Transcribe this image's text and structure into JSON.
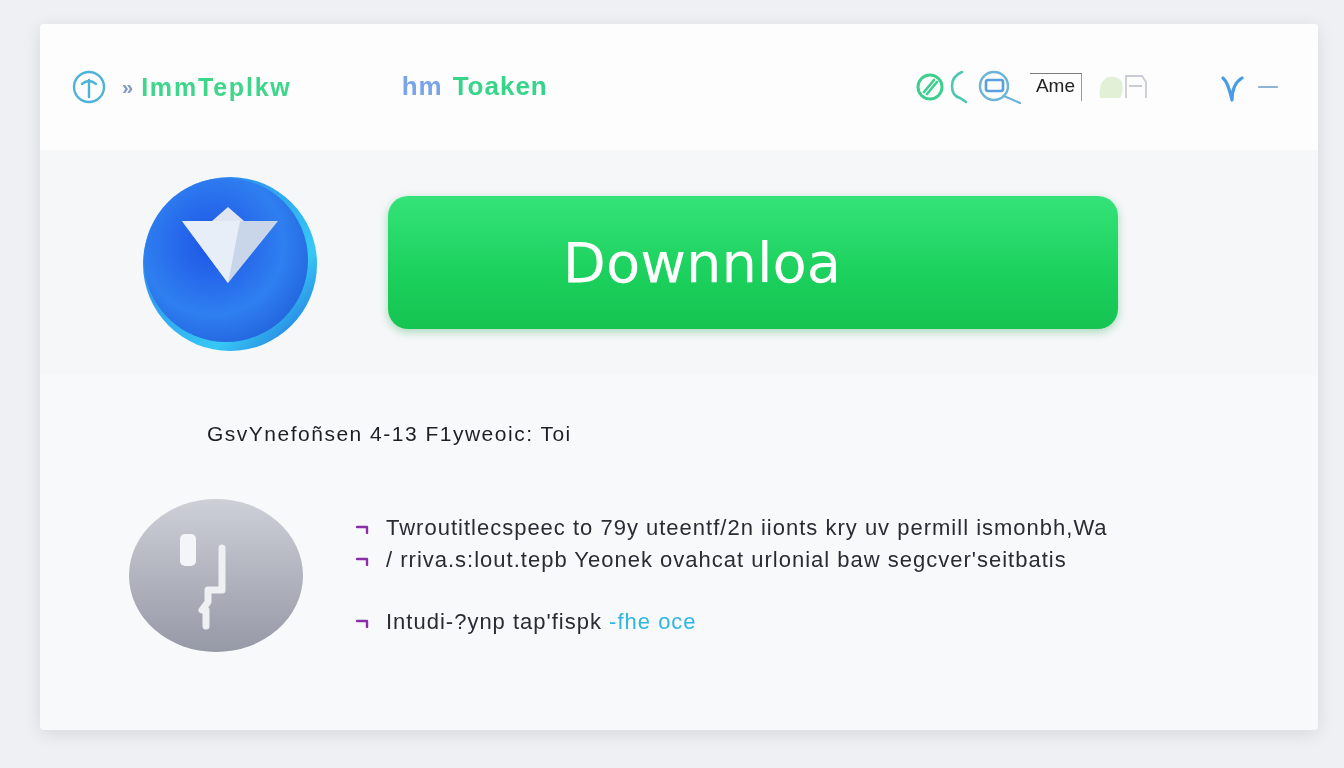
{
  "header": {
    "separator": "»",
    "title": "ImmTeplkw",
    "brand": {
      "prefix": "hm",
      "name": "Toaken"
    },
    "tab": "Ame"
  },
  "download_button": {
    "label": "Downnloa"
  },
  "subtitle": "GsvYnefoñsen 4-13 F1yweoic: Toi",
  "features": [
    {
      "text": "Twroutitlecspeec to 79y uteentf/2n iionts kry uv permill ismonbh,Wa"
    },
    {
      "text": "/ rriva.s:lout.tepb Yeonek ovahcat urlonial baw segcver'seitbatis"
    },
    {
      "text": "Intudi-?ynp tap'fispk",
      "link": "-fhe oce"
    }
  ]
}
